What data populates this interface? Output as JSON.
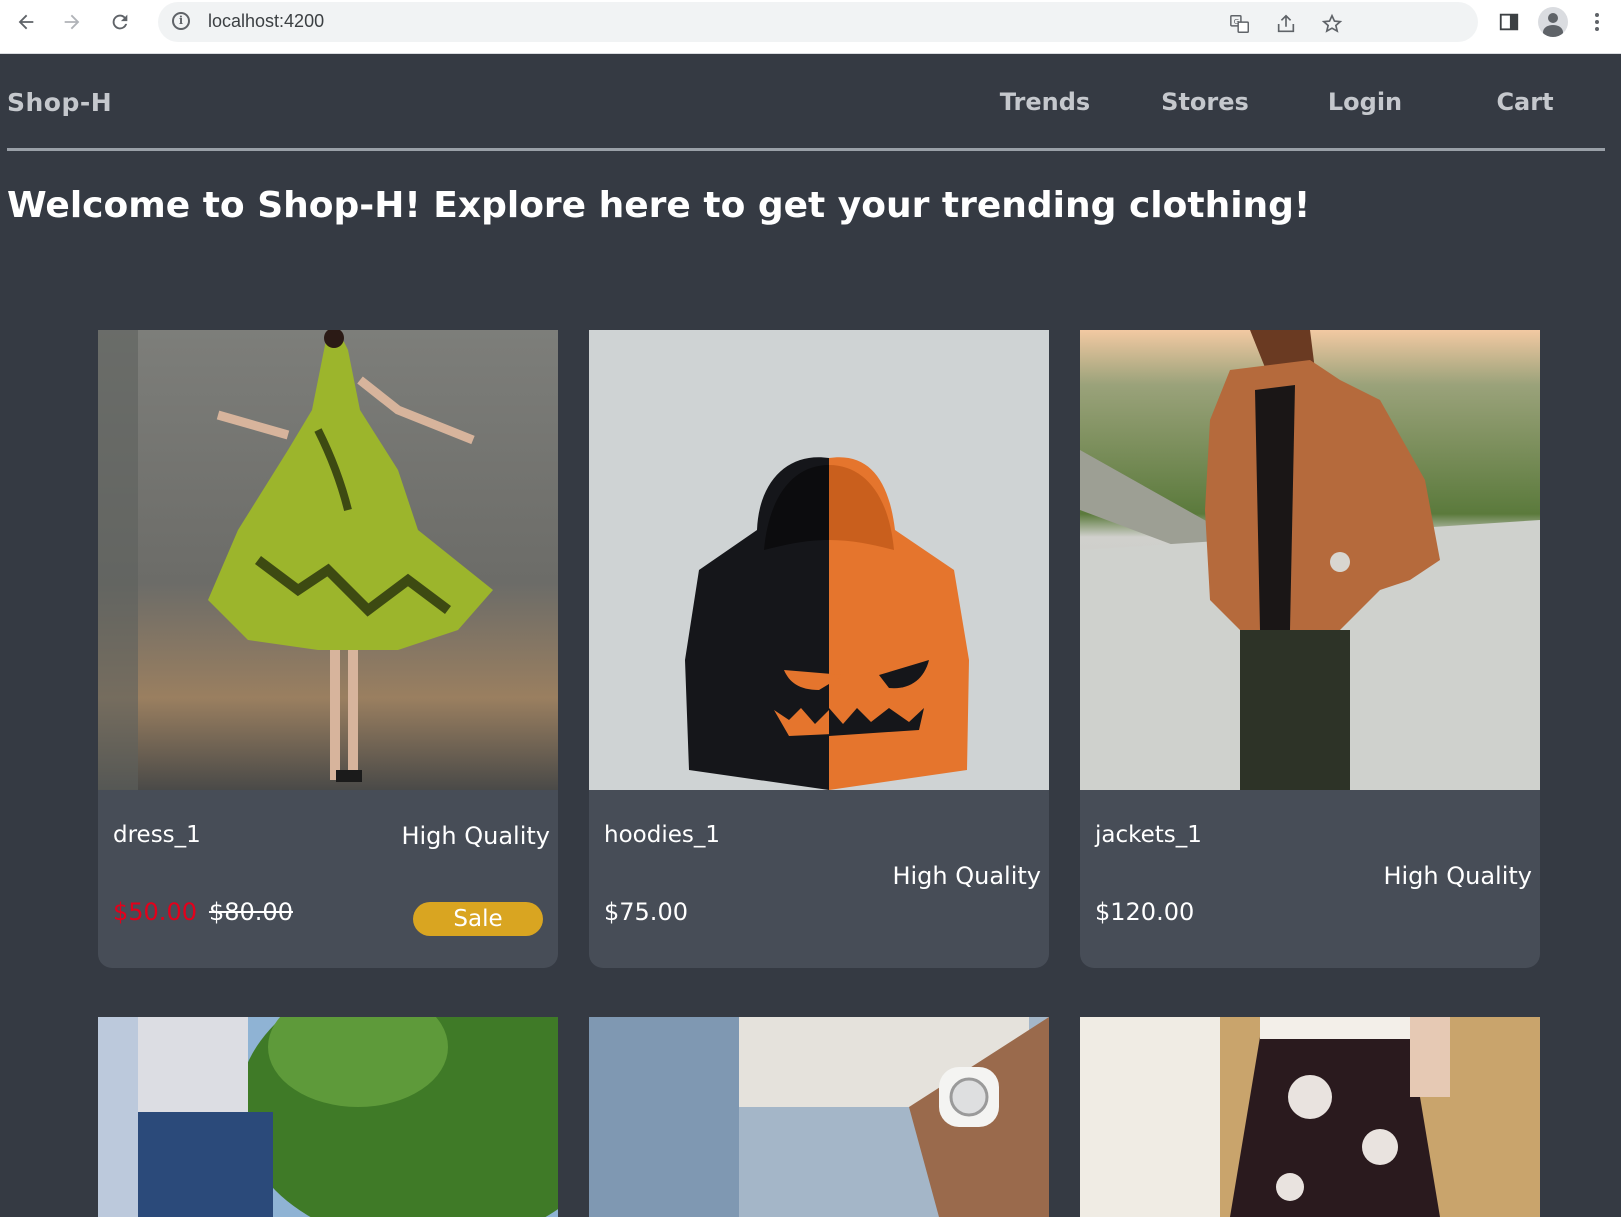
{
  "browser": {
    "url": "localhost:4200",
    "back_icon": "arrow-left-icon",
    "forward_icon": "arrow-right-icon",
    "reload_icon": "reload-icon"
  },
  "header": {
    "brand": "Shop-H",
    "nav": [
      "Trends",
      "Stores",
      "Login",
      "Cart"
    ]
  },
  "welcome": "Welcome to Shop-H! Explore here to get your trending clothing!",
  "products": [
    {
      "name": "dress_1",
      "quality": "High Quality",
      "sale_price": "$50.00",
      "original_price": "$80.00",
      "badge": "Sale"
    },
    {
      "name": "hoodies_1",
      "quality": "High Quality",
      "price": "$75.00"
    },
    {
      "name": "jackets_1",
      "quality": "High Quality",
      "price": "$120.00"
    }
  ],
  "colors": {
    "page_bg": "#353a43",
    "card_bg": "#474d57",
    "sale_red": "#e3001b",
    "badge_gold": "#d9a521"
  }
}
